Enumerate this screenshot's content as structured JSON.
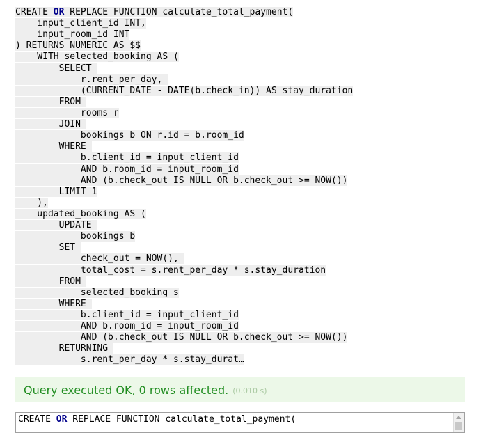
{
  "sql": {
    "lines": [
      {
        "pre": "CREATE ",
        "kw": "OR",
        "post": " REPLACE FUNCTION calculate_total_payment("
      },
      {
        "pre": "    input_client_id INT,",
        "kw": "",
        "post": ""
      },
      {
        "pre": "    input_room_id INT",
        "kw": "",
        "post": ""
      },
      {
        "pre": ") RETURNS NUMERIC AS $$",
        "kw": "",
        "post": ""
      },
      {
        "pre": "    WITH selected_booking AS (",
        "kw": "",
        "post": ""
      },
      {
        "pre": "        SELECT ",
        "kw": "",
        "post": ""
      },
      {
        "pre": "            r.rent_per_day, ",
        "kw": "",
        "post": ""
      },
      {
        "pre": "            (CURRENT_DATE - DATE(b.check_in)) AS stay_duration",
        "kw": "",
        "post": ""
      },
      {
        "pre": "        FROM ",
        "kw": "",
        "post": ""
      },
      {
        "pre": "            rooms r",
        "kw": "",
        "post": ""
      },
      {
        "pre": "        JOIN ",
        "kw": "",
        "post": ""
      },
      {
        "pre": "            bookings b ON r.id = b.room_id",
        "kw": "",
        "post": ""
      },
      {
        "pre": "        WHERE ",
        "kw": "",
        "post": ""
      },
      {
        "pre": "            b.client_id = input_client_id",
        "kw": "",
        "post": ""
      },
      {
        "pre": "            AND b.room_id = input_room_id",
        "kw": "",
        "post": ""
      },
      {
        "pre": "            AND (b.check_out IS NULL OR b.check_out >= NOW())",
        "kw": "",
        "post": ""
      },
      {
        "pre": "        LIMIT 1",
        "kw": "",
        "post": ""
      },
      {
        "pre": "    ),",
        "kw": "",
        "post": ""
      },
      {
        "pre": "    updated_booking AS (",
        "kw": "",
        "post": ""
      },
      {
        "pre": "        UPDATE ",
        "kw": "",
        "post": ""
      },
      {
        "pre": "            bookings b",
        "kw": "",
        "post": ""
      },
      {
        "pre": "        SET ",
        "kw": "",
        "post": ""
      },
      {
        "pre": "            check_out = NOW(), ",
        "kw": "",
        "post": ""
      },
      {
        "pre": "            total_cost = s.rent_per_day * s.stay_duration",
        "kw": "",
        "post": ""
      },
      {
        "pre": "        FROM ",
        "kw": "",
        "post": ""
      },
      {
        "pre": "            selected_booking s",
        "kw": "",
        "post": ""
      },
      {
        "pre": "        WHERE ",
        "kw": "",
        "post": ""
      },
      {
        "pre": "            b.client_id = input_client_id",
        "kw": "",
        "post": ""
      },
      {
        "pre": "            AND b.room_id = input_room_id",
        "kw": "",
        "post": ""
      },
      {
        "pre": "            AND (b.check_out IS NULL OR b.check_out >= NOW())",
        "kw": "",
        "post": ""
      },
      {
        "pre": "        RETURNING ",
        "kw": "",
        "post": ""
      },
      {
        "pre": "            s.rent_per_day * s.stay_durat…",
        "kw": "",
        "post": ""
      }
    ]
  },
  "result": {
    "message": "Query executed OK, 0 rows affected.",
    "time": "(0.010 s)"
  },
  "editor": {
    "pre": "CREATE ",
    "kw": "OR",
    "post": " REPLACE FUNCTION calculate_total_payment("
  },
  "colors": {
    "keyword": "#00008b",
    "line_highlight": "#eeeeee",
    "success_bg": "#ecf8e8",
    "success_text": "#218d21"
  }
}
